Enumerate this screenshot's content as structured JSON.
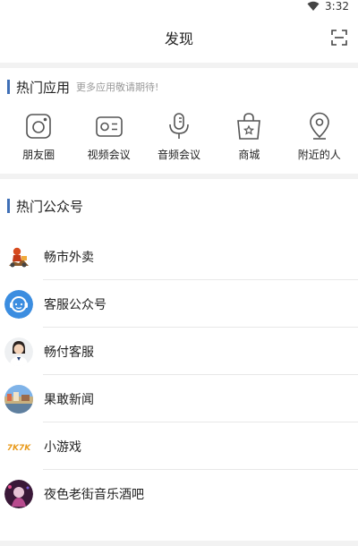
{
  "status": {
    "time": "3:32",
    "wifi_icon": "wifi-icon"
  },
  "header": {
    "title": "发现",
    "scan_icon": "scan-icon"
  },
  "hot_apps": {
    "title": "热门应用",
    "subtitle": "更多应用敬请期待!",
    "items": [
      {
        "label": "朋友圈",
        "icon": "camera-icon"
      },
      {
        "label": "视频会议",
        "icon": "video-icon"
      },
      {
        "label": "音频会议",
        "icon": "microphone-icon"
      },
      {
        "label": "商城",
        "icon": "shopping-bag-icon"
      },
      {
        "label": "附近的人",
        "icon": "location-pin-icon"
      }
    ]
  },
  "public_accounts": {
    "title": "热门公众号",
    "items": [
      {
        "name": "畅市外卖",
        "avatar": "delivery-avatar-icon"
      },
      {
        "name": "客服公众号",
        "avatar": "customer-service-avatar-icon"
      },
      {
        "name": "畅付客服",
        "avatar": "agent-avatar-icon"
      },
      {
        "name": "果敢新闻",
        "avatar": "news-avatar-icon"
      },
      {
        "name": "小游戏",
        "avatar": "game-logo-icon",
        "logo_text": "7K7K"
      },
      {
        "name": "夜色老街音乐酒吧",
        "avatar": "bar-avatar-icon"
      }
    ]
  },
  "colors": {
    "accent": "#3f6fb6",
    "icon_stroke": "#555555",
    "divider": "#f2f2f2"
  }
}
